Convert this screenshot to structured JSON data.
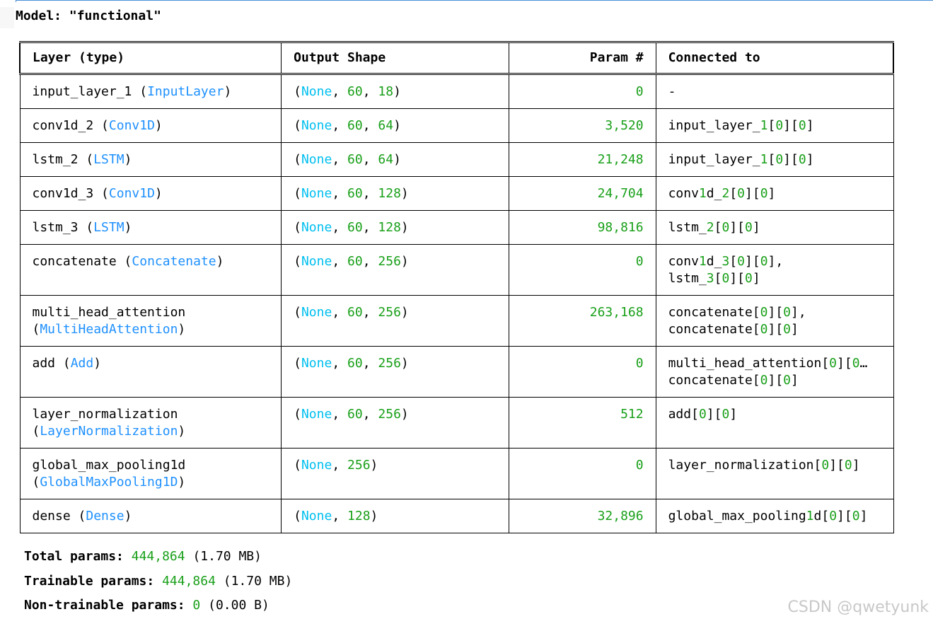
{
  "title": "Model: \"functional\"",
  "columns": {
    "layer": "Layer (type)",
    "output": "Output Shape",
    "params": "Param #",
    "connected": "Connected to"
  },
  "rows": [
    {
      "name": "input_layer_1",
      "type": "InputLayer",
      "dims": [
        "60",
        "18"
      ],
      "params": "0",
      "connected": "-"
    },
    {
      "name": "conv1d_2",
      "type": "Conv1D",
      "dims": [
        "60",
        "64"
      ],
      "params": "3,520",
      "connected": "input_layer_1[0][0]"
    },
    {
      "name": "lstm_2",
      "type": "LSTM",
      "dims": [
        "60",
        "64"
      ],
      "params": "21,248",
      "connected": "input_layer_1[0][0]"
    },
    {
      "name": "conv1d_3",
      "type": "Conv1D",
      "dims": [
        "60",
        "128"
      ],
      "params": "24,704",
      "connected": "conv1d_2[0][0]"
    },
    {
      "name": "lstm_3",
      "type": "LSTM",
      "dims": [
        "60",
        "128"
      ],
      "params": "98,816",
      "connected": "lstm_2[0][0]"
    },
    {
      "name": "concatenate",
      "type": "Concatenate",
      "dims": [
        "60",
        "256"
      ],
      "params": "0",
      "connected": "conv1d_3[0][0],\nlstm_3[0][0]"
    },
    {
      "name": "multi_head_attention",
      "type": "MultiHeadAttention",
      "dims": [
        "60",
        "256"
      ],
      "params": "263,168",
      "connected": "concatenate[0][0],\nconcatenate[0][0]"
    },
    {
      "name": "add",
      "type": "Add",
      "dims": [
        "60",
        "256"
      ],
      "params": "0",
      "connected": "multi_head_attention[0][0…\nconcatenate[0][0]"
    },
    {
      "name": "layer_normalization",
      "type": "LayerNormalization",
      "dims": [
        "60",
        "256"
      ],
      "params": "512",
      "connected": "add[0][0]"
    },
    {
      "name": "global_max_pooling1d",
      "type": "GlobalMaxPooling1D",
      "dims": [
        "256"
      ],
      "params": "0",
      "connected": "layer_normalization[0][0]"
    },
    {
      "name": "dense",
      "type": "Dense",
      "dims": [
        "128"
      ],
      "params": "32,896",
      "connected": "global_max_pooling1d[0][0]"
    }
  ],
  "none_label": "None",
  "totals": {
    "total_label": "Total params:",
    "total_value": "444,864",
    "total_size": "(1.70 MB)",
    "trainable_label": "Trainable params:",
    "trainable_value": "444,864",
    "trainable_size": "(1.70 MB)",
    "non_trainable_label": "Non-trainable params:",
    "non_trainable_value": "0",
    "non_trainable_size": "(0.00 B)"
  },
  "watermark": "CSDN @qwetyunk"
}
